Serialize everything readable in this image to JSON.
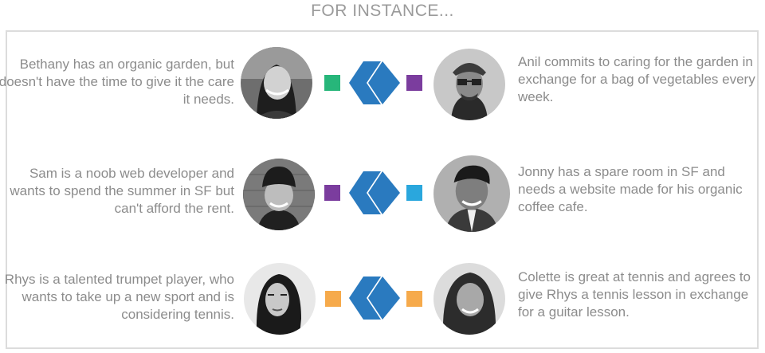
{
  "heading": "FOR INSTANCE...",
  "colors": {
    "green": "#27b67a",
    "purple": "#7b3d9e",
    "cyan": "#2aa7dd",
    "orange": "#f6aa4b",
    "chevron": "#2a7abf"
  },
  "icons": {
    "exchange": "double-chevron-left-icon"
  },
  "rows": [
    {
      "left": {
        "text": "Bethany has an organic garden, but doesn't have the time to give it the care it needs."
      },
      "right": {
        "text": "Anil commits to caring for the garden in exchange for a bag of vegetables every week."
      },
      "left_square": "green",
      "right_square": "purple"
    },
    {
      "left": {
        "text": "Sam is a noob web developer and wants to spend the summer in SF but can't afford the rent."
      },
      "right": {
        "text": "Jonny has a spare room in SF and needs a website made for his organic coffee cafe."
      },
      "left_square": "purple",
      "right_square": "cyan"
    },
    {
      "left": {
        "text": "Rhys is a talented trumpet player, who wants to take up a new sport and is considering tennis."
      },
      "right": {
        "text": "Colette is great at tennis and agrees to give Rhys a tennis lesson in exchange for a guitar lesson."
      },
      "left_square": "orange",
      "right_square": "orange"
    }
  ]
}
